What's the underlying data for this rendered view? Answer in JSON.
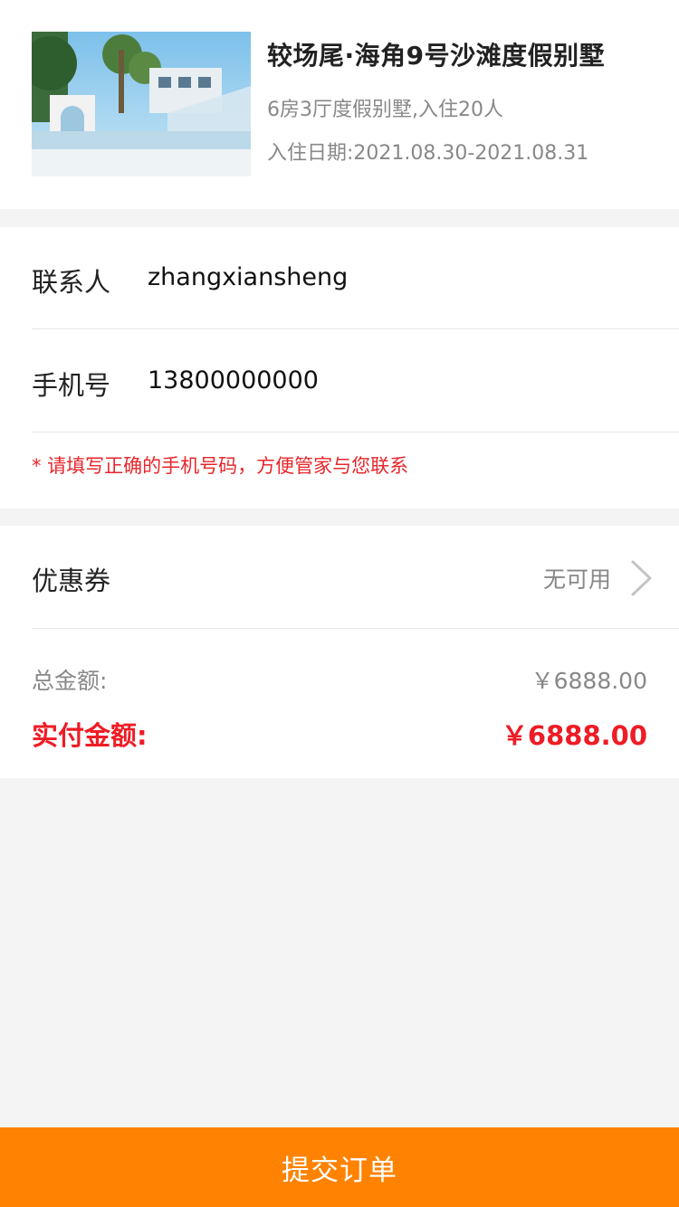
{
  "property": {
    "title": "较场尾·海角9号沙滩度假别墅",
    "description": "6房3厅度假别墅,入住20人",
    "dates": "入住日期:2021.08.30-2021.08.31"
  },
  "contact": {
    "name_label": "联系人",
    "name_value": "zhangxiansheng",
    "phone_label": "手机号",
    "phone_value": "13800000000",
    "hint": "* 请填写正确的手机号码，方便管家与您联系"
  },
  "coupon": {
    "label": "优惠券",
    "value": "无可用"
  },
  "totals": {
    "total_label": "总金额:",
    "total_value": "￥6888.00",
    "paid_label": "实付金额:",
    "paid_value": "￥6888.00"
  },
  "submit_label": "提交订单",
  "colors": {
    "accent": "#ff8200",
    "price_red": "#ee1c25",
    "hint_red": "#e8262b",
    "page_bg": "#f4f4f4"
  }
}
